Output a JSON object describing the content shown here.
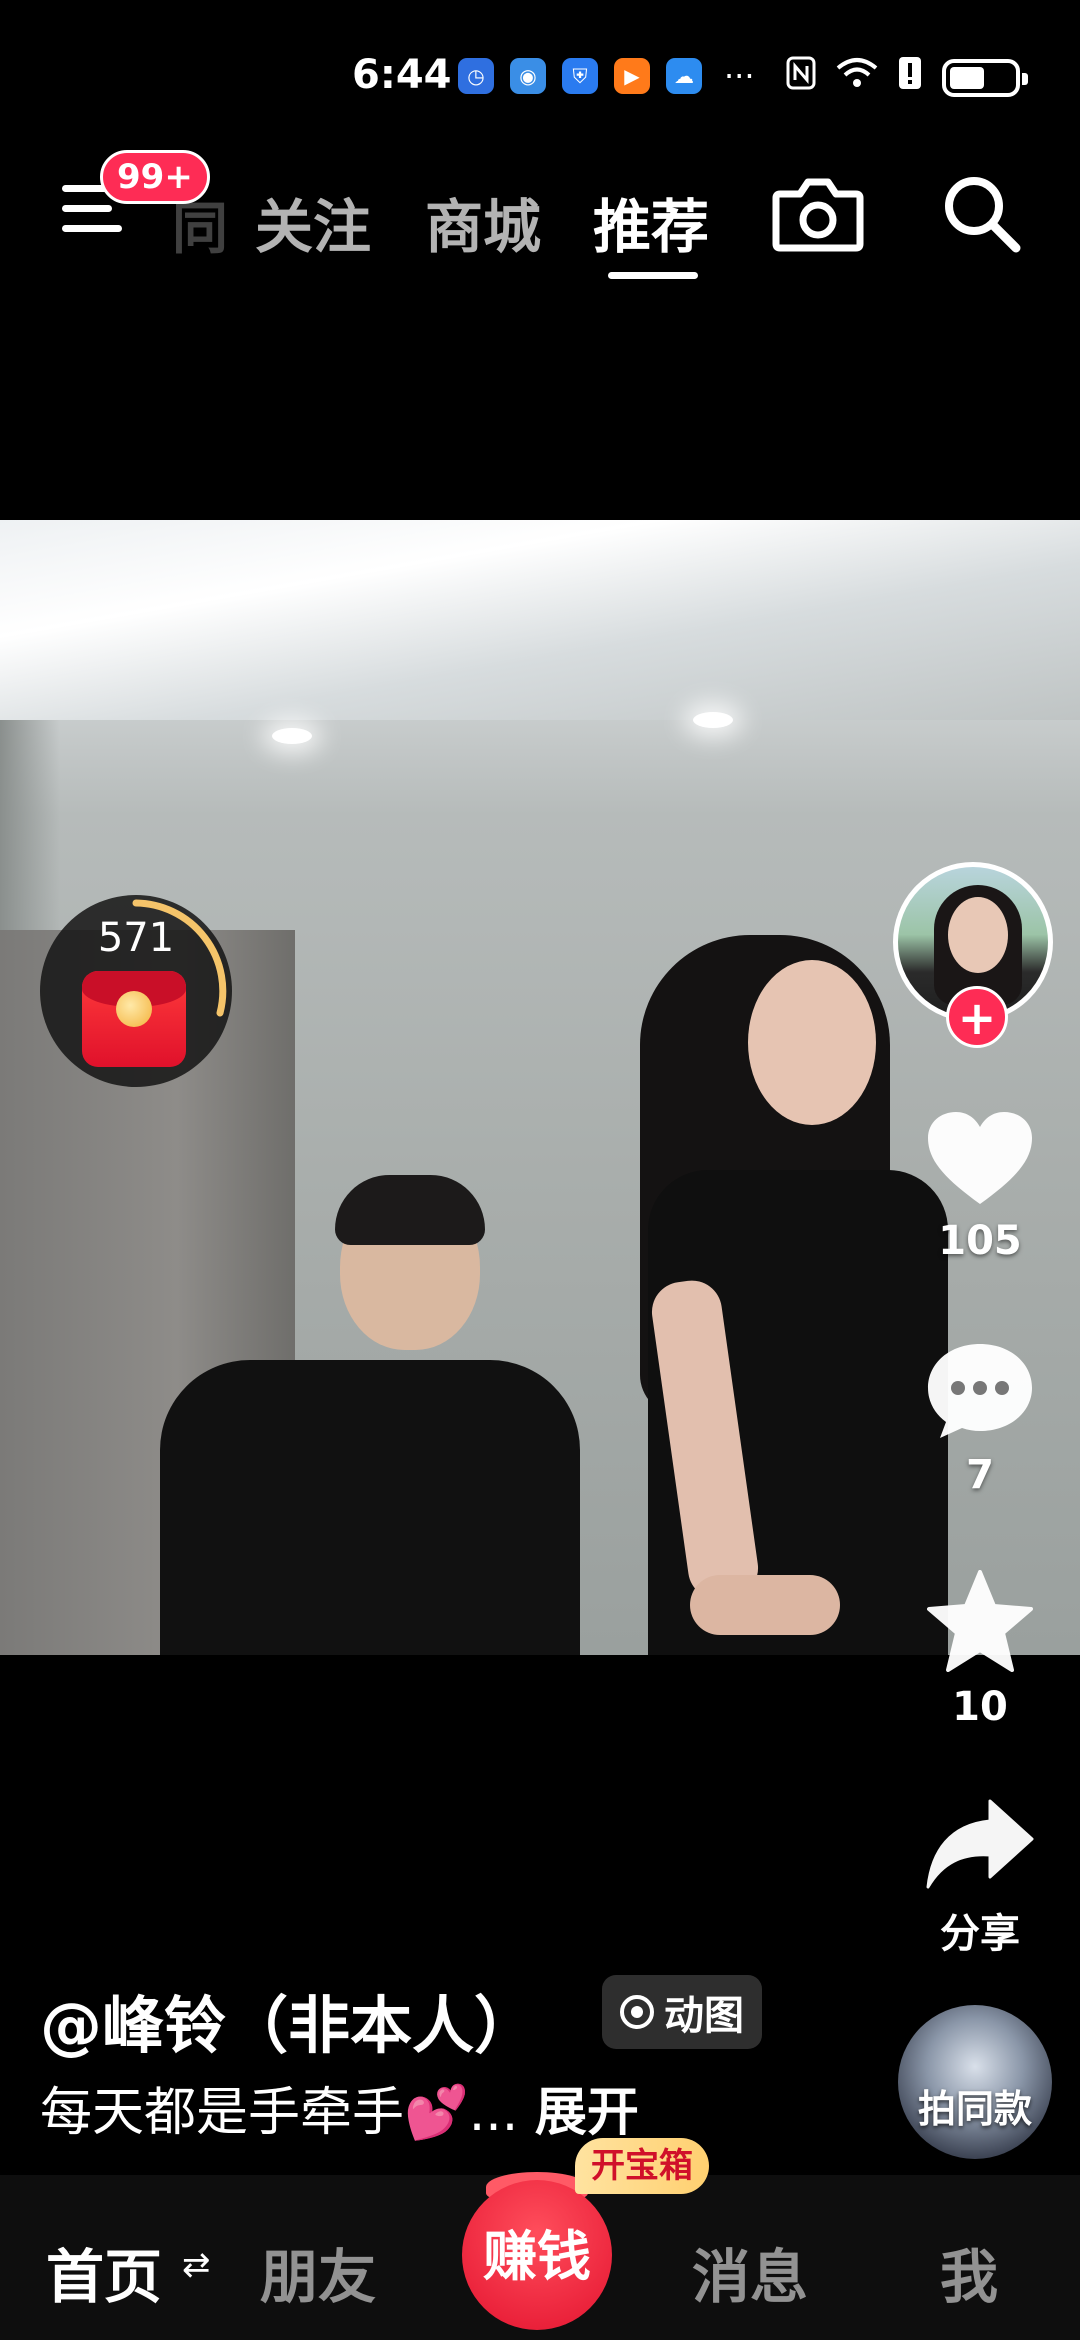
{
  "status_bar": {
    "time": "6:44",
    "app_icons": [
      {
        "name": "alarm-app-icon",
        "color": "#2f6fe0",
        "glyph": "◷"
      },
      {
        "name": "browser-app-icon",
        "color": "#3a8ee6",
        "glyph": "◉"
      },
      {
        "name": "shield-app-icon",
        "color": "#2a7bf0",
        "glyph": "⛨"
      },
      {
        "name": "video-app-icon",
        "color": "#ff7a1a",
        "glyph": "▶"
      },
      {
        "name": "cloud-app-icon",
        "color": "#2d8cf0",
        "glyph": "☁"
      }
    ],
    "more": "···"
  },
  "top_nav": {
    "menu_badge": "99+",
    "partial_tab": "同",
    "tabs": [
      "关注",
      "商城",
      "推荐"
    ],
    "active_tab": "推荐"
  },
  "red_packet": {
    "count": "571"
  },
  "actions": {
    "likes": "105",
    "comments": "7",
    "favorites": "10",
    "share": "分享"
  },
  "caption": {
    "author": "@峰铃（非本人）",
    "gif_tag": "动图",
    "description": "每天都是手牵手💕...",
    "expand": "展开"
  },
  "same_style": "拍同款",
  "bottom_bar": {
    "home": "首页",
    "switch": "⇄",
    "friends": "朋友",
    "earn": "赚钱",
    "chest": "开宝箱",
    "messages": "消息",
    "me": "我"
  },
  "colors": {
    "accent": "#fe2c55",
    "background": "#000000"
  }
}
